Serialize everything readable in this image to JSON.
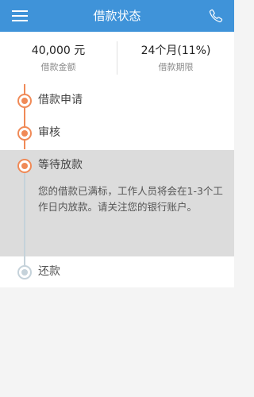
{
  "header": {
    "title": "借款状态",
    "menu_icon": "menu-icon",
    "phone_icon": "phone-icon"
  },
  "summary": {
    "amount_value": "40,000 元",
    "amount_label": "借款金额",
    "term_value": "24个月(11%)",
    "term_label": "借款期限"
  },
  "timeline": {
    "steps": [
      {
        "label": "借款申请",
        "status": "done"
      },
      {
        "label": "审核",
        "status": "done"
      },
      {
        "label": "等待放款",
        "status": "current",
        "description": "您的借款已满标，工作人员将会在1-3个工作日内放款。请关注您的银行账户。"
      },
      {
        "label": "还款",
        "status": "pending"
      }
    ]
  },
  "colors": {
    "header_bg": "#3f93d9",
    "active": "#f08a57",
    "pending": "#c5d2da",
    "current_bg": "#dcdcdc"
  }
}
